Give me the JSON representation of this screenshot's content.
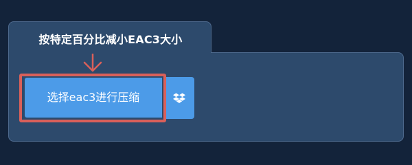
{
  "panel": {
    "tab_title": "按特定百分比减小EAC3大小"
  },
  "actions": {
    "select_button_label": "选择eac3进行压缩",
    "dropbox_icon": "dropbox-icon"
  },
  "colors": {
    "background": "#13233a",
    "panel": "#2d4a6c",
    "button": "#4c9be8",
    "highlight": "#d9605a"
  }
}
